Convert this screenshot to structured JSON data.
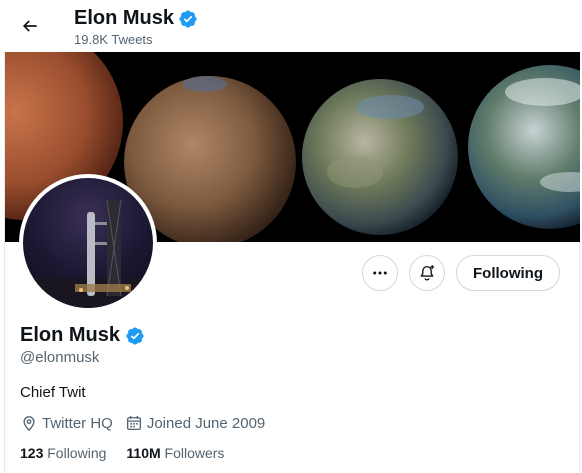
{
  "header": {
    "name": "Elon Musk",
    "tweet_count": "19.8K Tweets"
  },
  "profile": {
    "name": "Elon Musk",
    "handle": "@elonmusk",
    "bio": "Chief Twit",
    "location": "Twitter HQ",
    "joined": "Joined June 2009",
    "following_count": "123",
    "following_label": "Following",
    "followers_count": "110M",
    "followers_label": "Followers"
  },
  "actions": {
    "follow_label": "Following"
  },
  "icons": {
    "back": "arrow-left-icon",
    "verified": "verified-badge-icon",
    "more": "more-icon",
    "notify": "bell-plus-icon",
    "location": "location-icon",
    "calendar": "calendar-icon"
  },
  "colors": {
    "verified": "#1d9bf0",
    "secondary_text": "#536471",
    "border": "#cfd9de"
  }
}
